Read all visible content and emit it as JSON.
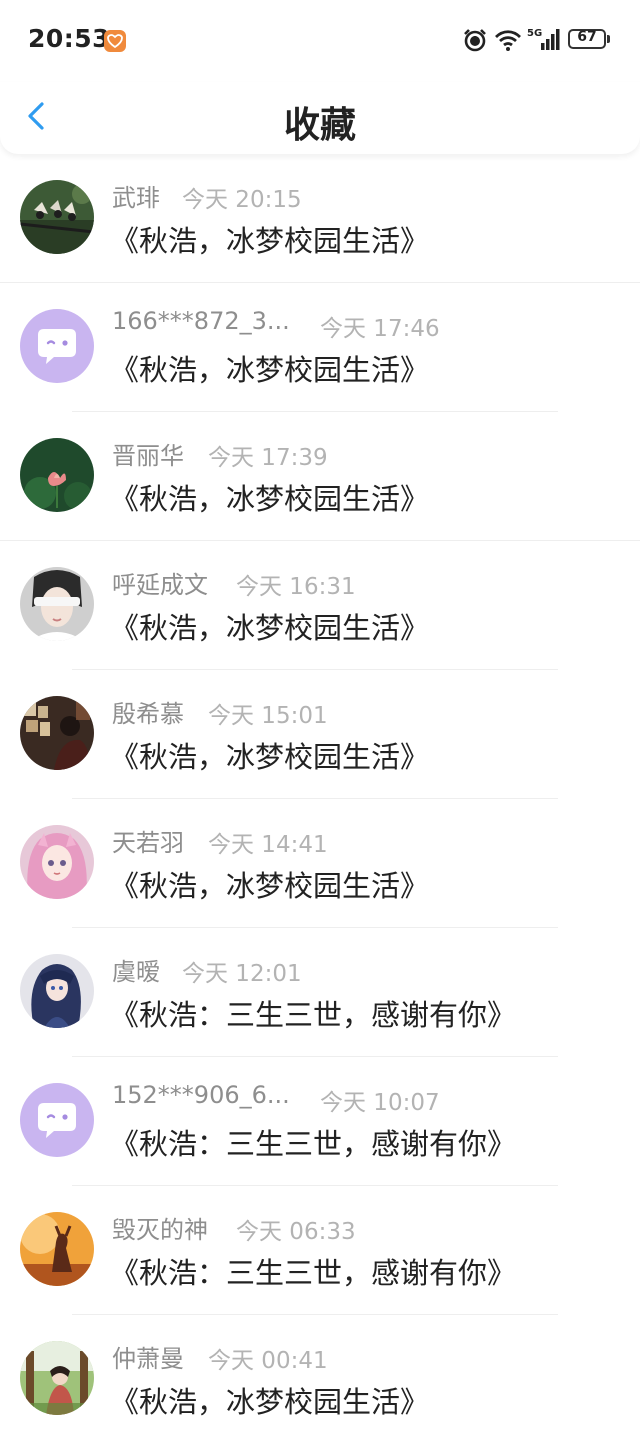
{
  "status_bar": {
    "time": "20:53",
    "battery": "67"
  },
  "header": {
    "title": "收藏"
  },
  "items": [
    {
      "name": "武琲",
      "time": "今天 20:15",
      "title": "《秋浩，冰梦校园生活》",
      "avatar": "forest-birds"
    },
    {
      "name": "166***872_3...",
      "time": "今天 17:46",
      "title": "《秋浩，冰梦校园生活》",
      "avatar": "default-chat"
    },
    {
      "name": "晋丽华",
      "time": "今天 17:39",
      "title": "《秋浩，冰梦校园生活》",
      "avatar": "lotus"
    },
    {
      "name": "呼延成文",
      "time": "今天 16:31",
      "title": "《秋浩，冰梦校园生活》",
      "avatar": "blindfold-girl"
    },
    {
      "name": "殷希慕",
      "time": "今天 15:01",
      "title": "《秋浩，冰梦校园生活》",
      "avatar": "dark-room-person"
    },
    {
      "name": "天若羽",
      "time": "今天 14:41",
      "title": "《秋浩，冰梦校园生活》",
      "avatar": "anime-pink-hair"
    },
    {
      "name": "虞暧",
      "time": "今天 12:01",
      "title": "《秋浩：三生三世，感谢有你》",
      "avatar": "anime-blue-hair"
    },
    {
      "name": "152***906_6...",
      "time": "今天 10:07",
      "title": "《秋浩：三生三世，感谢有你》",
      "avatar": "default-chat"
    },
    {
      "name": "毁灭的神",
      "time": "今天 06:33",
      "title": "《秋浩：三生三世，感谢有你》",
      "avatar": "sunset-figure"
    },
    {
      "name": "仲萧曼",
      "time": "今天 00:41",
      "title": "《秋浩，冰梦校园生活》",
      "avatar": "garden-girl"
    }
  ]
}
